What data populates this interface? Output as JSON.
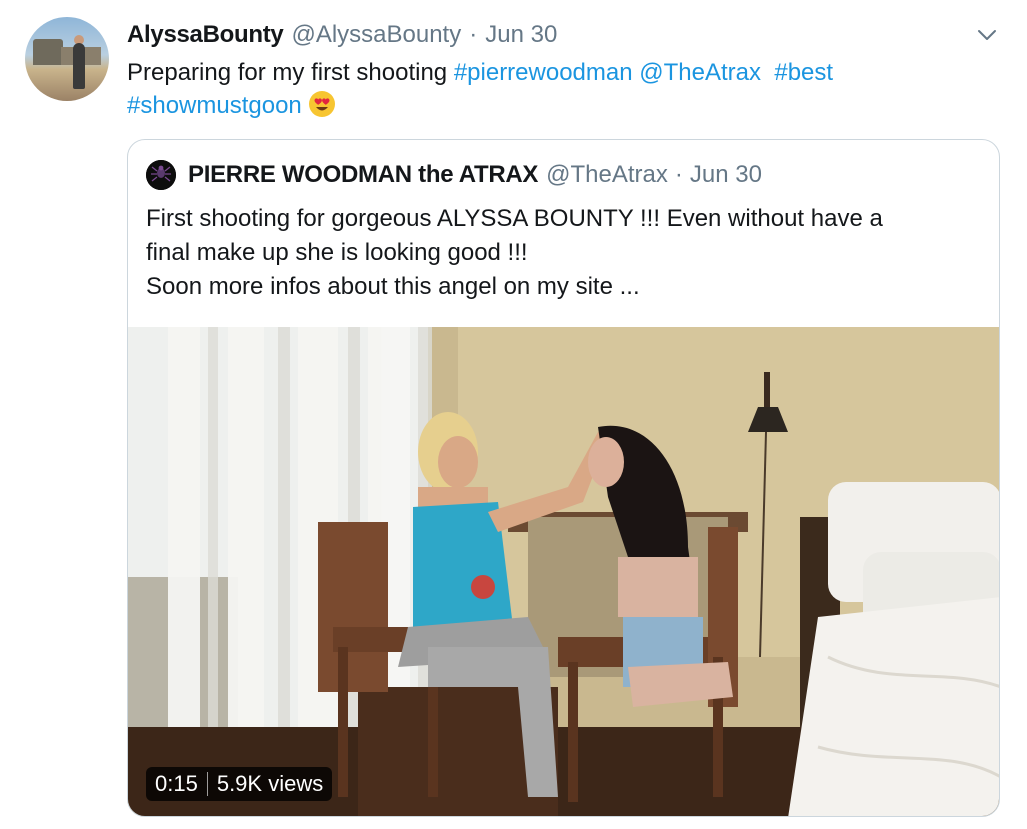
{
  "author": {
    "name": "AlyssaBounty",
    "handle": "@AlyssaBounty",
    "separator": "·",
    "date": "Jun 30"
  },
  "tweet": {
    "text_intro": "Preparing for my first shooting",
    "hashtag_1": "#pierrewoodman",
    "mention": "@TheAtrax",
    "hashtag_2": "#best",
    "hashtag_3": "#showmustgoon",
    "emoji": "smiling-face-with-heart-eyes"
  },
  "quoted_tweet": {
    "name": "PIERRE WOODMAN the ATRAX",
    "handle": "@TheAtrax",
    "separator": "·",
    "date": "Jun 30",
    "lines": [
      "First shooting for gorgeous ALYSSA BOUNTY !!! Even without have a",
      "final make up she is looking good !!!",
      "Soon more infos about this angel on my site ..."
    ],
    "video": {
      "duration": "0:15",
      "views": "5.9K views"
    }
  },
  "colors": {
    "link": "#1b95e0",
    "text": "#14171a",
    "muted": "#657786",
    "border": "#ccd6dd"
  }
}
